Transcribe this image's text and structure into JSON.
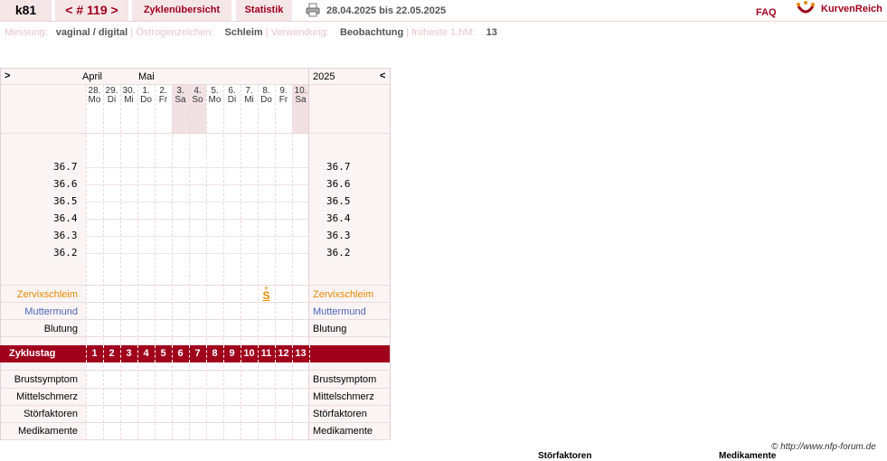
{
  "header": {
    "user": "k81",
    "cycle": "< # 119 >",
    "nav": [
      "Zyklenübersicht",
      "Statistik"
    ],
    "date_range": "28.04.2025 bis 22.05.2025",
    "faq": "FAQ",
    "brand": "KurvenReich",
    "icons": [
      "printer-icon",
      "kurvenreich-logo-icon"
    ]
  },
  "info": {
    "measure_label": "Messung:",
    "measure_value": "vaginal / digital",
    "estrogen_label": "Östrogenzeichen:",
    "estrogen_value": "Schleim",
    "usage_label": "Verwendung:",
    "usage_value": "Beobachtung",
    "earliest_label": "früheste 1.hM:",
    "earliest_value": "13"
  },
  "chart": {
    "nav_prev": ">",
    "nav_next": "<",
    "months": [
      "April",
      "Mai"
    ],
    "year": "2025",
    "days": [
      {
        "d": "28.",
        "w": "Mo",
        "weekend": false
      },
      {
        "d": "29.",
        "w": "Di",
        "weekend": false
      },
      {
        "d": "30.",
        "w": "Mi",
        "weekend": false
      },
      {
        "d": "1.",
        "w": "Do",
        "weekend": false
      },
      {
        "d": "2.",
        "w": "Fr",
        "weekend": false
      },
      {
        "d": "3.",
        "w": "Sa",
        "weekend": true
      },
      {
        "d": "4.",
        "w": "So",
        "weekend": true
      },
      {
        "d": "5.",
        "w": "Mo",
        "weekend": false
      },
      {
        "d": "6.",
        "w": "Di",
        "weekend": false
      },
      {
        "d": "7.",
        "w": "Mi",
        "weekend": false
      },
      {
        "d": "8.",
        "w": "Do",
        "weekend": false
      },
      {
        "d": "9.",
        "w": "Fr",
        "weekend": false
      },
      {
        "d": "10.",
        "w": "Sa",
        "weekend": true
      }
    ],
    "temperatures": [
      "36.7",
      "36.6",
      "36.5",
      "36.4",
      "36.3",
      "36.2"
    ],
    "rows_top": {
      "mucus": "Zervixschleim",
      "cervix": "Muttermund",
      "bleeding": "Blutung"
    },
    "mucus_entry": {
      "day_index": 10,
      "symbol": "S",
      "mark": "+"
    },
    "cycle_label": "Zyklustag",
    "cycle_days": [
      "1",
      "2",
      "3",
      "4",
      "5",
      "6",
      "7",
      "8",
      "9",
      "10",
      "11",
      "12",
      "13"
    ],
    "rows_bottom": [
      "Brustsymptom",
      "Mittelschmerz",
      "Störfaktoren",
      "Medikamente"
    ]
  },
  "footer": {
    "watermark": "© http://www.nfp-forum.de",
    "cut_off_left": "Störfaktoren",
    "cut_off_right": "Medikamente"
  }
}
